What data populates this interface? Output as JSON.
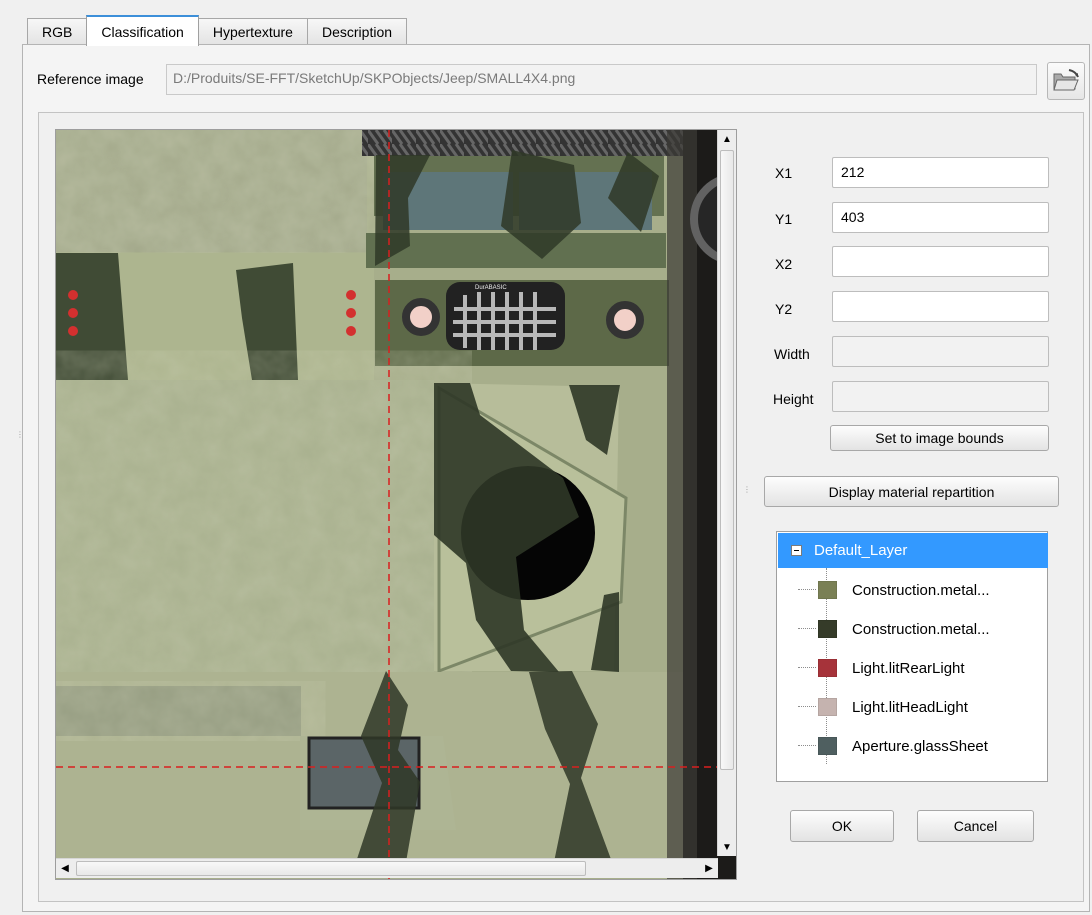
{
  "tabs": [
    {
      "label": "RGB",
      "active": false
    },
    {
      "label": "Classification",
      "active": true
    },
    {
      "label": "Hypertexture",
      "active": false
    },
    {
      "label": "Description",
      "active": false
    }
  ],
  "reference": {
    "label": "Reference image",
    "path": "D:/Produits/SE-FFT/SketchUp/SKPObjects/Jeep/SMALL4X4.png"
  },
  "viewer": {
    "icons": [
      "arrow-up-icon",
      "arrow-down-icon",
      "arrow-left-icon",
      "arrow-right-icon",
      "folder-open-icon"
    ],
    "texture_labels": [
      "DurABASIC"
    ]
  },
  "form": {
    "x1": {
      "label": "X1",
      "value": "212"
    },
    "y1": {
      "label": "Y1",
      "value": "403"
    },
    "x2": {
      "label": "X2",
      "value": ""
    },
    "y2": {
      "label": "Y2",
      "value": ""
    },
    "width": {
      "label": "Width",
      "value": ""
    },
    "height": {
      "label": "Height",
      "value": ""
    },
    "set_bounds": "Set to image bounds"
  },
  "display_repartition": "Display material repartition",
  "tree": {
    "root": "Default_Layer",
    "items": [
      {
        "label": "Construction.metal...",
        "color": "#7a8055"
      },
      {
        "label": "Construction.metal...",
        "color": "#353b29"
      },
      {
        "label": "Light.litRearLight",
        "color": "#a6333a"
      },
      {
        "label": "Light.litHeadLight",
        "color": "#c5b3af"
      },
      {
        "label": "Aperture.glassSheet",
        "color": "#4f5f60"
      }
    ]
  },
  "buttons": {
    "ok": "OK",
    "cancel": "Cancel"
  },
  "colors": {
    "selection": "#3399ff",
    "crosshair": "#d91f1f"
  }
}
